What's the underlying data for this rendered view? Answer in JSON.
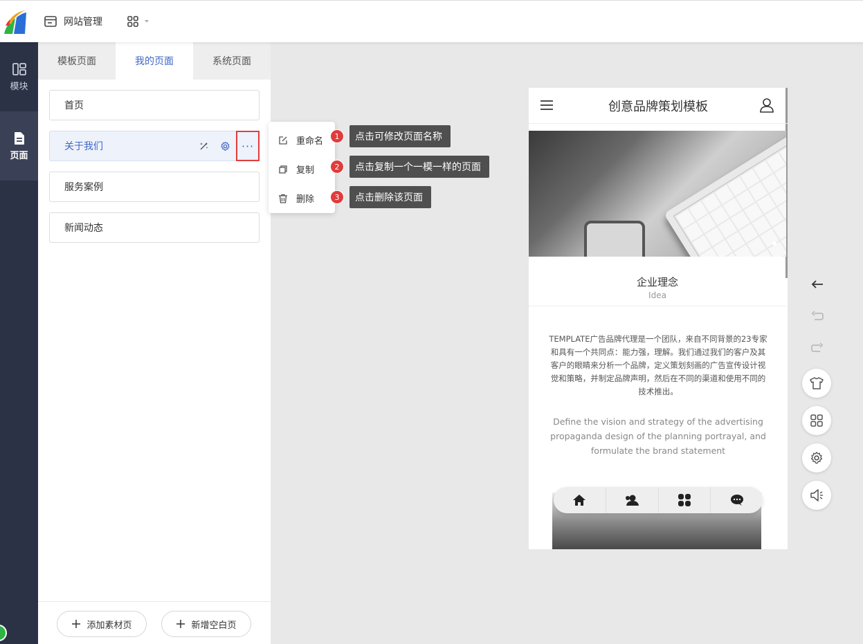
{
  "topbar": {
    "site_manage_label": "网站管理"
  },
  "rail": {
    "items": [
      {
        "label": "模块",
        "icon": "module-icon"
      },
      {
        "label": "页面",
        "icon": "page-icon"
      }
    ]
  },
  "panel": {
    "tabs": [
      "模板页面",
      "我的页面",
      "系统页面"
    ],
    "active_tab": "我的页面",
    "pages": [
      {
        "label": "首页"
      },
      {
        "label": "关于我们"
      },
      {
        "label": "服务案例"
      },
      {
        "label": "新闻动态"
      }
    ],
    "more_label": "···",
    "footer": {
      "add_material_label": "添加素材页",
      "add_blank_label": "新增空白页"
    }
  },
  "context_menu": {
    "items": [
      {
        "label": "重命名",
        "icon": "edit-icon"
      },
      {
        "label": "复制",
        "icon": "copy-icon"
      },
      {
        "label": "删除",
        "icon": "trash-icon"
      }
    ]
  },
  "tips": [
    {
      "num": "1",
      "text": "点击可修改页面名称"
    },
    {
      "num": "2",
      "text": "点击复制一个一模一样的页面"
    },
    {
      "num": "3",
      "text": "点击删除该页面"
    }
  ],
  "phone": {
    "title": "创意品牌策划模板",
    "section_title": "企业理念",
    "section_sub": "Idea",
    "text_cn": "TEMPLATE广告品牌代理是一个团队，来自不同背景的23专家和具有一个共同点：能力强，理解。我们通过我们的客户及其客户的眼睛来分析一个品牌，定义策划刻画的广告宣传设计视觉和策略，并制定品牌声明，然后在不同的渠道和使用不同的技术推出。",
    "text_en": "Define the vision and strategy of the advertising propaganda design of the planning portrayal, and formulate the brand statement",
    "nav_icons": [
      "home-icon",
      "users-icon",
      "grid-icon",
      "chat-icon"
    ]
  },
  "colors": {
    "accent": "#3f66c7",
    "rail_bg": "#2c3246",
    "highlight_red": "#e03c3c"
  }
}
